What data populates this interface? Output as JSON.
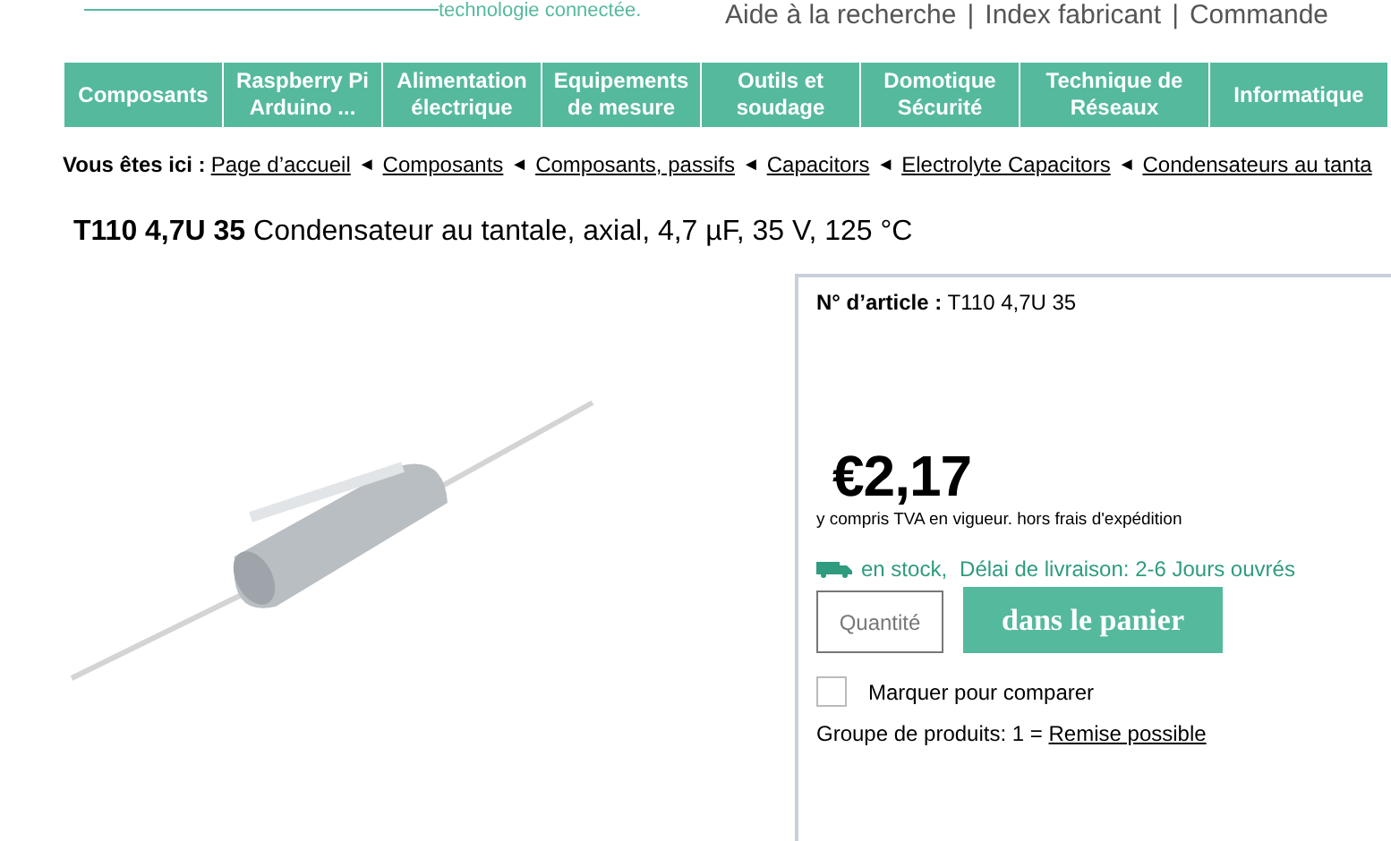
{
  "header": {
    "tagline": "technologie connectée.",
    "links": [
      "Aide à la recherche",
      "Index fabricant",
      "Commande"
    ],
    "separator": "|"
  },
  "nav": [
    {
      "label": "Composants"
    },
    {
      "label": "Raspberry Pi Arduino ..."
    },
    {
      "label": "Alimentation électrique"
    },
    {
      "label": "Equipements de mesure"
    },
    {
      "label": "Outils et soudage"
    },
    {
      "label": "Domotique Sécurité"
    },
    {
      "label": "Technique de Réseaux"
    },
    {
      "label": "Informatique"
    }
  ],
  "breadcrumb": {
    "label": "Vous êtes ici :",
    "arrow": "◄",
    "items": [
      "Page d’accueil",
      "Composants",
      "Composants, passifs",
      "Capacitors",
      "Electrolyte Capacitors",
      "Condensateurs au tanta"
    ]
  },
  "product": {
    "title": "**T110 4,7U 35** Condensateur au tantale, axial, 4,7 µF, 35 V, 125 °C"
  },
  "buy_box": {
    "article_label": "N° d’article :",
    "article_number": "T110 4,7U 35",
    "price": "€2,17",
    "price_note": "y compris TVA en vigueur. hors frais d'expédition",
    "stock": "en stock,",
    "delivery": "Délai de livraison: 2-6 Jours ouvrés",
    "quantity": {
      "placeholder": "Quantité"
    },
    "cart_button": "dans le panier",
    "compare": {
      "label": "Marquer pour comparer",
      "checked": false
    },
    "group_text": "Groupe de produits: 1 =",
    "group_link": "Remise possible"
  }
}
